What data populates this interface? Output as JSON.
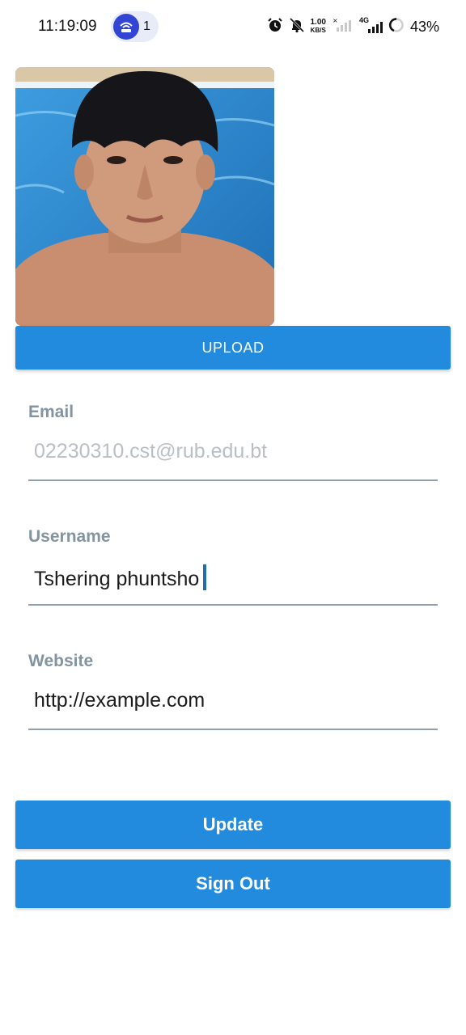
{
  "status_bar": {
    "time": "11:19:09",
    "hotspot_count": "1",
    "net_speed_value": "1.00",
    "net_speed_unit": "KB/S",
    "network_type": "4G",
    "battery": "43%"
  },
  "profile": {
    "avatar_icon": "profile-photo",
    "upload_label": "UPLOAD"
  },
  "form": {
    "email": {
      "label": "Email",
      "value": "02230310.cst@rub.edu.bt"
    },
    "username": {
      "label": "Username",
      "value": "Tshering phuntsho"
    },
    "website": {
      "label": "Website",
      "value": "http://example.com"
    }
  },
  "actions": {
    "update_label": "Update",
    "signout_label": "Sign Out"
  },
  "colors": {
    "primary": "#238bdd",
    "label": "#8293a1",
    "underline": "#8fa1ae",
    "hotspot": "#3346d3"
  }
}
